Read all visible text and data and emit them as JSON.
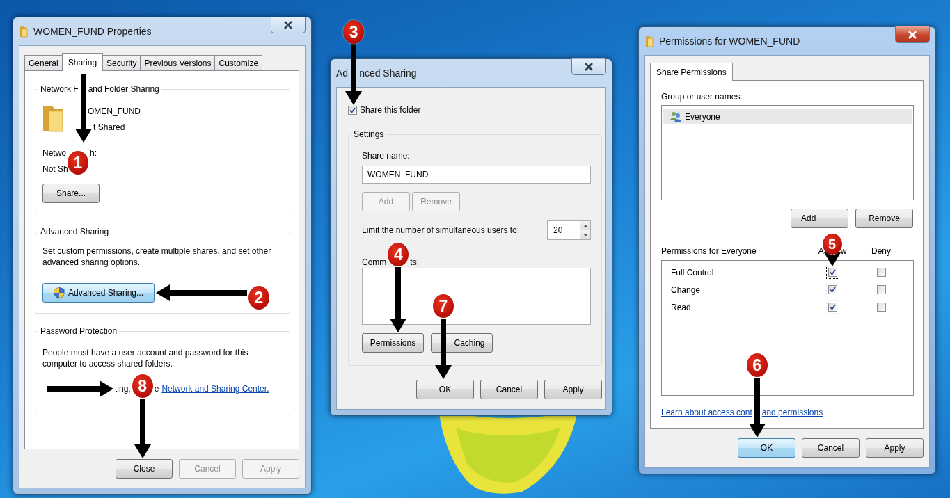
{
  "properties_window": {
    "title": "WOMEN_FUND Properties",
    "active": false,
    "tabs": [
      {
        "label": "General",
        "selected": false
      },
      {
        "label": "Sharing",
        "selected": true
      },
      {
        "label": "Security",
        "selected": false
      },
      {
        "label": "Previous Versions",
        "selected": false
      },
      {
        "label": "Customize",
        "selected": false
      }
    ],
    "network_sharing": {
      "legend": [
        "Network F",
        "and Folder Sharing"
      ],
      "folder_name": "OMEN_FUND",
      "folder_status": "t Shared",
      "path_label": [
        "Netwo",
        "h:"
      ],
      "path_value": "Not Sh",
      "share_button": "Share..."
    },
    "advanced_sharing": {
      "legend": "Advanced Sharing",
      "description": "Set custom permissions, create multiple shares, and set other advanced sharing options.",
      "button": {
        "label": "Advanced Sharing...",
        "default": true
      }
    },
    "password_protection": {
      "legend": "Password Protection",
      "description": "People must have a user account and password for this computer to access shared folders.",
      "hint": [
        "ting,",
        "e"
      ],
      "link": "Network and Sharing Center."
    },
    "buttons": [
      {
        "label": "Close",
        "disabled": false,
        "default": false
      },
      {
        "label": "Cancel",
        "disabled": true,
        "default": false
      },
      {
        "label": "Apply",
        "disabled": true,
        "default": false
      }
    ]
  },
  "advanced_window": {
    "title": [
      "Ad",
      "nced Sharing"
    ],
    "active": false,
    "share_checkbox": {
      "label": "Share this folder",
      "checked": true
    },
    "settings": {
      "legend": "Settings",
      "share_name_label": "Share name:",
      "share_name": "WOMEN_FUND",
      "add": {
        "label": "Add",
        "disabled": true
      },
      "remove": {
        "label": "Remove",
        "disabled": true
      },
      "limit_label": "Limit the number of simultaneous users to:",
      "limit_value": "20",
      "comments_label": [
        "Comm",
        "ts:"
      ],
      "permissions_button": "Permissions",
      "caching_button": "Caching"
    },
    "buttons": [
      {
        "label": "OK",
        "disabled": false,
        "default": false
      },
      {
        "label": "Cancel",
        "disabled": false,
        "default": false
      },
      {
        "label": "Apply",
        "disabled": false,
        "default": false
      }
    ]
  },
  "permissions_window": {
    "title": "Permissions for WOMEN_FUND",
    "active": true,
    "tabs": [
      {
        "label": "Share Permissions",
        "selected": true
      }
    ],
    "group_label": "Group or user names:",
    "users": [
      {
        "name": "Everyone",
        "selected": true
      }
    ],
    "add_button": "Add",
    "remove_button": "Remove",
    "permissions_label": "Permissions for Everyone",
    "allow_header": [
      "A",
      "w"
    ],
    "deny_header": "Deny",
    "permissions": [
      {
        "name": "Full Control",
        "allow": true,
        "deny": false,
        "focused": true
      },
      {
        "name": "Change",
        "allow": true,
        "deny": false,
        "focused": false
      },
      {
        "name": "Read",
        "allow": true,
        "deny": false,
        "focused": false
      }
    ],
    "link": [
      "Learn about access cont",
      "and permissions"
    ],
    "buttons": [
      {
        "label": "OK",
        "disabled": false,
        "default": true
      },
      {
        "label": "Cancel",
        "disabled": false,
        "default": false
      },
      {
        "label": "Apply",
        "disabled": false,
        "default": false
      }
    ]
  },
  "step_markers": [
    "1",
    "2",
    "3",
    "4",
    "5",
    "6",
    "7",
    "8"
  ]
}
